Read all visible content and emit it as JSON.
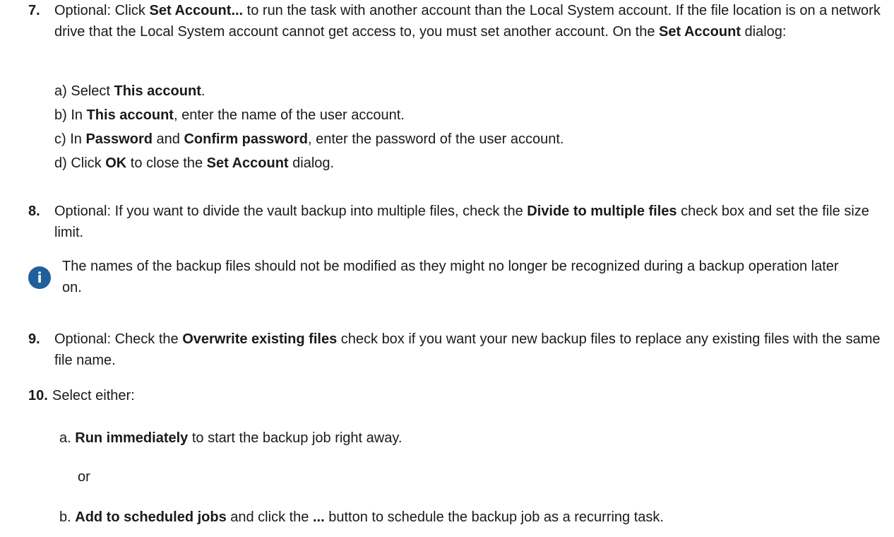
{
  "step7": {
    "num": "7.",
    "t1": "Optional: Click ",
    "b1": "Set Account...",
    "t2": " to run the task with another account than the Local System account. If the file location is on a network drive that the Local System account cannot get access to, you must set another account. On the ",
    "b2": "Set Account",
    "t3": " dialog:",
    "sub": [
      {
        "label": "a)",
        "t1": " Select ",
        "b1": "This account",
        "t2": ".",
        "b2": "",
        "t3": "",
        "b3": "",
        "t4": ""
      },
      {
        "label": "b)",
        "t1": " In ",
        "b1": "This account",
        "t2": ", enter the name of the user account.",
        "b2": "",
        "t3": "",
        "b3": "",
        "t4": ""
      },
      {
        "label": "c)",
        "t1": " In ",
        "b1": "Password",
        "t2": " and ",
        "b2": "Confirm password",
        "t3": ", enter the password of the user account.",
        "b3": "",
        "t4": ""
      },
      {
        "label": "d)",
        "t1": " Click ",
        "b1": "OK",
        "t2": " to close the ",
        "b2": "Set Account",
        "t3": " dialog.",
        "b3": "",
        "t4": ""
      }
    ]
  },
  "step8": {
    "num": "8.",
    "t1": "Optional: If you want to divide the vault backup into multiple files, check the ",
    "b1": "Divide to multiple files",
    "t2": " check box and set the file size limit."
  },
  "note": {
    "icon": "info-icon",
    "icon_glyph": "i",
    "icon_color": "#1f5f9c",
    "text": "The names of the backup files should not be modified as they might no longer be recognized during a backup operation later on."
  },
  "step9": {
    "num": "9.",
    "t1": "Optional: Check the ",
    "b1": "Overwrite existing files",
    "t2": " check box if you want your new backup files to replace any existing files with the same file name."
  },
  "step10": {
    "num": "10.",
    "text": "Select either:",
    "option_a": {
      "label": "a.",
      "b1": "Run immediately",
      "t1": " to start the backup job right away."
    },
    "or": "or",
    "option_b": {
      "label": "b.",
      "b1": "Add to scheduled jobs",
      "t1": " and click the ",
      "b2": "...",
      "t2": " button to schedule the backup job as a recurring task."
    }
  }
}
